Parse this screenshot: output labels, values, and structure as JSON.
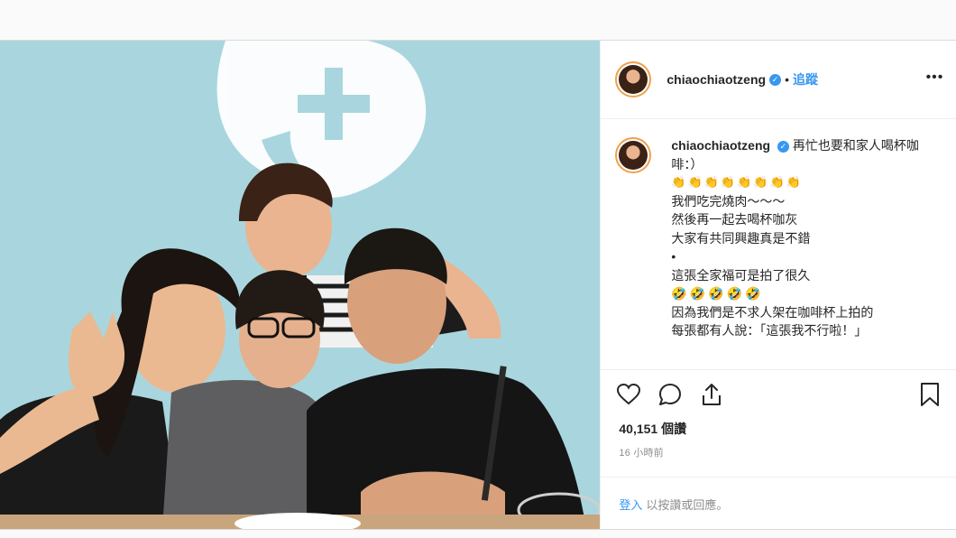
{
  "post": {
    "username": "chiaochiaotzeng",
    "verified_badge": "✓",
    "separator": "•",
    "follow_label": "追蹤",
    "more_label": "•••",
    "photo_icon": "family-photo",
    "caption": {
      "line1": "再忙也要和家人喝杯咖啡：）",
      "emoji_row1": "👏👏👏👏👏👏👏👏",
      "line2": "我們吃完燒肉～～～",
      "line3": "然後再一起去喝杯咖灰",
      "line4": "大家有共同興趣真是不錯",
      "line5": "•",
      "line6": "這張全家福可是拍了很久",
      "emoji_row2": "🤣🤣🤣🤣🤣",
      "line7": "因為我們是不求人架在咖啡杯上拍的",
      "line8": "每張都有人說：「這張我不行啦！」"
    },
    "likes": "40,151 個讚",
    "time_ago": "16 小時前",
    "comment": {
      "login_label": "登入",
      "rest_label": "以按讚或回應。"
    }
  },
  "colors": {
    "accent": "#3897f0",
    "border": "#efefef",
    "wall": "#a9d6de"
  }
}
